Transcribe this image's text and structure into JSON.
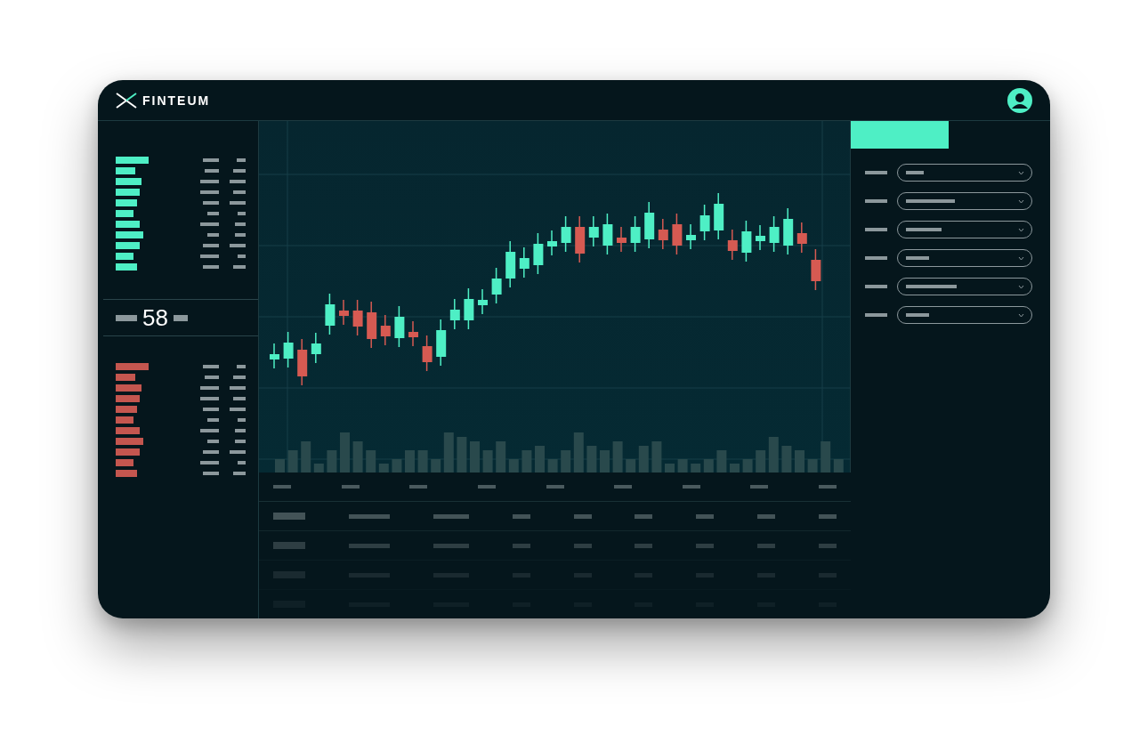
{
  "header": {
    "brand": "FINTEUM"
  },
  "order_book": {
    "mid_price": "58"
  }
}
